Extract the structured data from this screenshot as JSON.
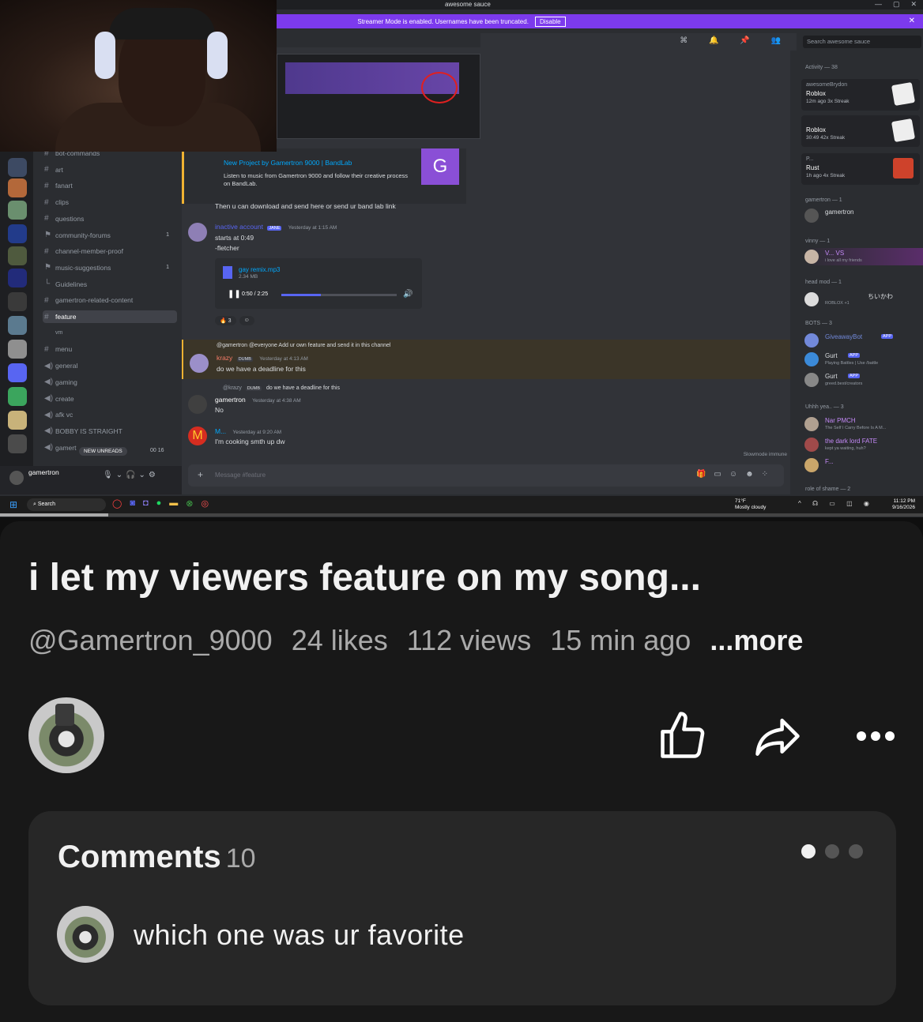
{
  "video": {
    "window_title": "awesome sauce",
    "streamer_mode_text": "Streamer Mode is enabled. Usernames have been truncated.",
    "streamer_disable": "Disable",
    "search_placeholder": "Search awesome sauce",
    "channels": [
      {
        "type": "text",
        "label": "bot-commands"
      },
      {
        "type": "text",
        "label": "art"
      },
      {
        "type": "text",
        "label": "fanart"
      },
      {
        "type": "text",
        "label": "clips"
      },
      {
        "type": "text",
        "label": "questions"
      },
      {
        "type": "forum",
        "label": "community-forums",
        "count": "1"
      },
      {
        "type": "text",
        "label": "channel-member-proof"
      },
      {
        "type": "forum",
        "label": "music-suggestions",
        "count": "1"
      },
      {
        "type": "sub",
        "label": "Guidelines"
      },
      {
        "type": "text",
        "label": "gamertron-related-content"
      },
      {
        "type": "text",
        "label": "feature",
        "active": true
      },
      {
        "type": "category",
        "label": "vm"
      },
      {
        "type": "text",
        "label": "menu"
      },
      {
        "type": "voice",
        "label": "general"
      },
      {
        "type": "voice",
        "label": "gaming"
      },
      {
        "type": "voice",
        "label": "create"
      },
      {
        "type": "voice",
        "label": "afk vc"
      },
      {
        "type": "voice",
        "label": "BOBBY IS STRAIGHT"
      },
      {
        "type": "voice",
        "label": "gamert"
      }
    ],
    "new_unreads": "NEW UNREADS",
    "voice_timer": "00 16",
    "user_name": "gamertron",
    "embed_title": "New Project by Gamertron 9000 | BandLab",
    "embed_desc": "Listen to music from Gamertron 9000 and follow their creative process on BandLab.",
    "embed_thumb": "G",
    "msg1": "Then u can download and send here or send ur band lab link",
    "msg2_author": "inactive account",
    "msg2_tag": "JANE",
    "msg2_time": "Yesterday at 1:15 AM",
    "msg2_line1": "starts at 0:49",
    "msg2_line2": "-fletcher",
    "audio_file": "gay remix.mp3",
    "audio_size": "2.34 MB",
    "audio_time": "0:50 / 2:25",
    "audio_progress": 0.34,
    "reaction_count": "3",
    "reply_preview": "@gamertron @everyone Add ur own feature and send it in this channel",
    "msg3_author": "krazy",
    "msg3_tag": "DUMB",
    "msg3_time": "Yesterday at 4:13 AM",
    "msg3_text": "do we have a deadline for this",
    "reply2_preview": "@krazy",
    "reply2_tag": "DUMB",
    "reply2_text": "do we have a deadline for this",
    "msg4_author": "gamertron",
    "msg4_time": "Yesterday at 4:38 AM",
    "msg4_text": "No",
    "msg5_author": "M...",
    "msg5_time": "Yesterday at 9:20 AM",
    "msg5_text": "I'm cooking smth up dw",
    "slowmode": "Slowmode immune",
    "composer_placeholder": "Message #feature",
    "members": {
      "activity_header": "Activity — 38",
      "activities": [
        {
          "user": "awesomeBrydon",
          "game": "Roblox",
          "stats": "12m ago   3x Streak"
        },
        {
          "user": "",
          "game": "Roblox",
          "stats": "30:49   42x Streak"
        },
        {
          "user": "P...",
          "game": "Rust",
          "stats": "1h ago   4x Streak"
        }
      ],
      "sections": [
        {
          "header": "gamertron — 1",
          "members": [
            {
              "name": "gamertron",
              "sub": ""
            }
          ]
        },
        {
          "header": "vinny — 1",
          "members": [
            {
              "name": "V...  VS",
              "sub": "i love all my friends"
            }
          ]
        },
        {
          "header": "head mod — 1",
          "members": [
            {
              "name": "ちいかわ",
              "sub": "ROBLOX +1"
            }
          ]
        },
        {
          "header": "BOTS — 3",
          "members": [
            {
              "name": "GiveawayBot",
              "sub": "",
              "app": "APP"
            },
            {
              "name": "Gurt",
              "sub": "Playing Battles | Use /battle",
              "app": "APP"
            },
            {
              "name": "Gurt",
              "sub": "greed.best/creators",
              "app": "APP"
            }
          ]
        },
        {
          "header": "Uhhh yea.. — 3",
          "members": [
            {
              "name": "Nar  PMCH",
              "sub": "The Self I Carry Before Is A M..."
            },
            {
              "name": "the dark lord  FATE",
              "sub": "kept ya waiting, huh?"
            },
            {
              "name": "F...",
              "sub": ""
            }
          ]
        },
        {
          "header": "role of shame — 2",
          "members": []
        }
      ]
    },
    "taskbar": {
      "search": "Search",
      "weather_temp": "71°F",
      "weather_desc": "Mostly cloudy",
      "time": "11:12 PM",
      "date": "9/16/2026"
    },
    "video_progress": 0.117
  },
  "post": {
    "title": "i let my viewers feature on my song...",
    "handle": "@Gamertron_9000",
    "likes": "24 likes",
    "views": "112 views",
    "age": "15 min ago",
    "more": "...more"
  },
  "comments": {
    "header": "Comments",
    "count": "10",
    "first_comment": "which one was ur favorite",
    "pager_active": 0
  },
  "icons": {
    "like": "thumbs-up-icon",
    "share": "share-arrow-icon",
    "more": "more-dots-icon"
  }
}
